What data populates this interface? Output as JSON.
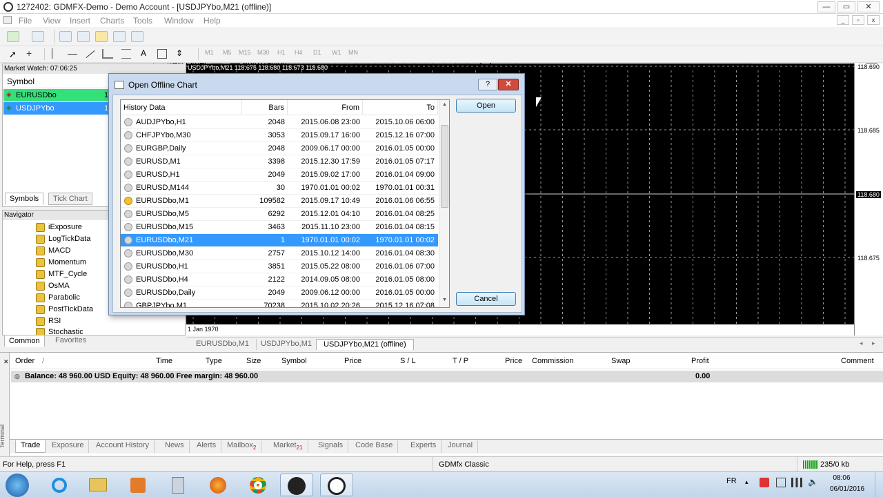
{
  "window": {
    "title": "1272402: GDMFX-Demo - Demo Account - [USDJPYbo,M21 (offline)]",
    "controls": {
      "minimize": "—",
      "maximize": "▭",
      "close": "✕"
    }
  },
  "menu": [
    "File",
    "View",
    "Insert",
    "Charts",
    "Tools",
    "Window",
    "Help"
  ],
  "toolbar": {
    "new_order": "New Order",
    "autotrading": "AutoTrading",
    "timeframes": [
      "M1",
      "M5",
      "M15",
      "M30",
      "H1",
      "H4",
      "D1",
      "W1",
      "MN"
    ],
    "drawing_text_label": "A"
  },
  "market_watch": {
    "title": "Market Watch: 07:06:25",
    "column": "Symbol",
    "rows": [
      {
        "symbol": "EURUSDbo",
        "bid": "1"
      },
      {
        "symbol": "USDJPYbo",
        "bid": "1"
      }
    ],
    "tabs": [
      "Symbols",
      "Tick Chart"
    ]
  },
  "navigator": {
    "title": "Navigator",
    "items": [
      "iExposure",
      "LogTickData",
      "MACD",
      "Momentum",
      "MTF_Cycle",
      "OsMA",
      "Parabolic",
      "PostTickData",
      "RSI",
      "Stochastic"
    ],
    "tabs": [
      "Common",
      "Favorites"
    ]
  },
  "chart": {
    "caption": "USDJPYbo,M21  118.675 118.680 118.673 118.680",
    "prices": [
      "118.690",
      "118.685",
      "118.680",
      "118.675"
    ],
    "time_label": "1 Jan 1970",
    "tabs": [
      "EURUSDbo,M1",
      "USDJPYbo,M1",
      "USDJPYbo,M21 (offline)"
    ]
  },
  "dialog": {
    "title": "Open Offline Chart",
    "help": "?",
    "close": "✕",
    "headers": [
      "History Data",
      "Bars",
      "From",
      "To"
    ],
    "rows": [
      {
        "name": "AUDJPYbo,H1",
        "bars": "2048",
        "from": "2015.06.08 23:00",
        "to": "2015.10.06 06:00"
      },
      {
        "name": "CHFJPYbo,M30",
        "bars": "3053",
        "from": "2015.09.17 16:00",
        "to": "2015.12.16 07:00"
      },
      {
        "name": "EURGBP,Daily",
        "bars": "2048",
        "from": "2009.06.17 00:00",
        "to": "2016.01.05 00:00"
      },
      {
        "name": "EURUSD,M1",
        "bars": "3398",
        "from": "2015.12.30 17:59",
        "to": "2016.01.05 07:17"
      },
      {
        "name": "EURUSD,H1",
        "bars": "2049",
        "from": "2015.09.02 17:00",
        "to": "2016.01.04 09:00"
      },
      {
        "name": "EURUSD,M144",
        "bars": "30",
        "from": "1970.01.01 00:02",
        "to": "1970.01.01 00:31"
      },
      {
        "name": "EURUSDbo,M1",
        "bars": "109582",
        "from": "2015.09.17 10:49",
        "to": "2016.01.06 06:55"
      },
      {
        "name": "EURUSDbo,M5",
        "bars": "6292",
        "from": "2015.12.01 04:10",
        "to": "2016.01.04 08:25"
      },
      {
        "name": "EURUSDbo,M15",
        "bars": "3463",
        "from": "2015.11.10 23:00",
        "to": "2016.01.04 08:15"
      },
      {
        "name": "EURUSDbo,M21",
        "bars": "1",
        "from": "1970.01.01 00:02",
        "to": "1970.01.01 00:02"
      },
      {
        "name": "EURUSDbo,M30",
        "bars": "2757",
        "from": "2015.10.12 14:00",
        "to": "2016.01.04 08:30"
      },
      {
        "name": "EURUSDbo,H1",
        "bars": "3851",
        "from": "2015.05.22 08:00",
        "to": "2016.01.06 07:00"
      },
      {
        "name": "EURUSDbo,H4",
        "bars": "2122",
        "from": "2014.09.05 08:00",
        "to": "2016.01.05 08:00"
      },
      {
        "name": "EURUSDbo,Daily",
        "bars": "2049",
        "from": "2009.06.12 00:00",
        "to": "2016.01.05 00:00"
      },
      {
        "name": "GBPJPYbo,M1",
        "bars": "70238",
        "from": "2015.10.02 20:26",
        "to": "2015.12.16 07:08"
      }
    ],
    "selected_index": 9,
    "open_label": "Open",
    "cancel_label": "Cancel"
  },
  "terminal": {
    "side_label": "Terminal",
    "headers": [
      "Order",
      "/",
      "Time",
      "Type",
      "Size",
      "Symbol",
      "Price",
      "S / L",
      "T / P",
      "Price",
      "Commission",
      "Swap",
      "Profit",
      "Comment"
    ],
    "balance_text": "Balance: 48 960.00 USD  Equity: 48 960.00  Free margin: 48 960.00",
    "profit": "0.00",
    "tabs": [
      {
        "label": "Trade",
        "badge": ""
      },
      {
        "label": "Exposure",
        "badge": ""
      },
      {
        "label": "Account History",
        "badge": ""
      },
      {
        "label": "News",
        "badge": ""
      },
      {
        "label": "Alerts",
        "badge": ""
      },
      {
        "label": "Mailbox",
        "badge": "2"
      },
      {
        "label": "Market",
        "badge": "21"
      },
      {
        "label": "Signals",
        "badge": ""
      },
      {
        "label": "Code Base",
        "badge": ""
      },
      {
        "label": "Experts",
        "badge": ""
      },
      {
        "label": "Journal",
        "badge": ""
      }
    ]
  },
  "status": {
    "help": "For Help, press F1",
    "profile": "GDMfx Classic",
    "traffic": "235/0 kb"
  },
  "taskbar": {
    "lang": "FR",
    "time": "08:06",
    "date": "06/01/2016"
  }
}
